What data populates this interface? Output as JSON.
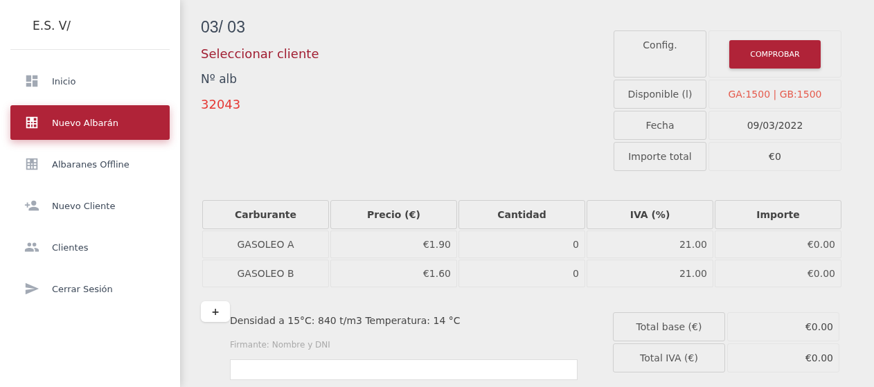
{
  "sidebar": {
    "brand": "E.S. V/",
    "items": [
      {
        "label": "Inicio",
        "selected": false
      },
      {
        "label": "Nuevo Albarán",
        "selected": true
      },
      {
        "label": "Albaranes Offline",
        "selected": false
      },
      {
        "label": "Nuevo Cliente",
        "selected": false
      },
      {
        "label": "Clientes",
        "selected": false
      },
      {
        "label": "Cerrar Sesión",
        "selected": false
      }
    ]
  },
  "header": {
    "date_title": "03/ 03",
    "select_client": "Seleccionar cliente",
    "number_label": "Nº alb",
    "number": "32043"
  },
  "info": [
    {
      "label": "Config.",
      "kind": "button",
      "value": "COMPROBAR"
    },
    {
      "label": "Disponible (l)",
      "kind": "alert",
      "value": "GA:1500 | GB:1500"
    },
    {
      "label": "Fecha",
      "kind": "text",
      "value": "09/03/2022"
    },
    {
      "label": "Importe total",
      "kind": "text",
      "value": "€0"
    }
  ],
  "table": {
    "columns": [
      "Carburante",
      "Precio (€)",
      "Cantidad",
      "IVA (%)",
      "Importe"
    ],
    "rows": [
      [
        "GASOLEO A",
        "€1.90",
        "0",
        "21.00",
        "€0.00"
      ],
      [
        "GASOLEO B",
        "€1.60",
        "0",
        "21.00",
        "€0.00"
      ]
    ]
  },
  "add_button": "+",
  "note": "Densidad a 15°C: 840 t/m3 Temperatura: 14 °C",
  "signer_label": "Firmante: Nombre y DNI",
  "totals": [
    {
      "label": "Total base (€)",
      "value": "€0.00"
    },
    {
      "label": "Total IVA (€)",
      "value": "€0.00"
    }
  ]
}
